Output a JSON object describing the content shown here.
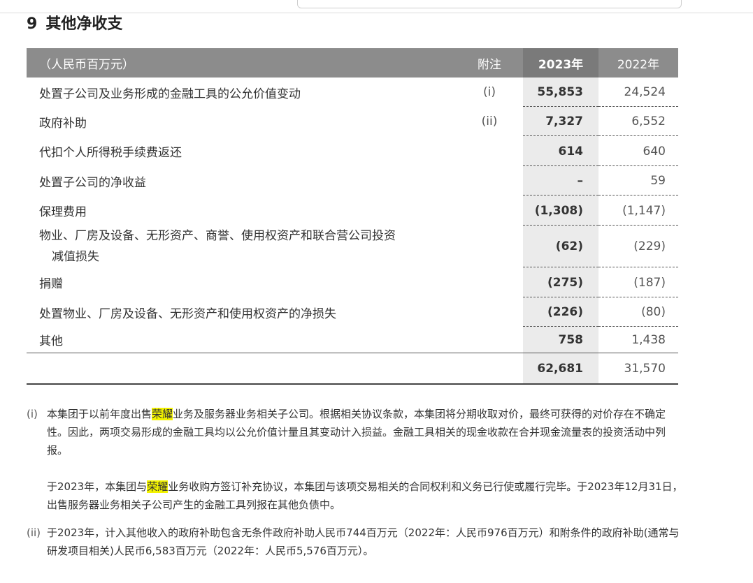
{
  "section": {
    "number": "9",
    "title": "其他净收支"
  },
  "table": {
    "header": {
      "label": "（人民币百万元）",
      "note": "附注",
      "col_2023": "2023年",
      "col_2022": "2022年"
    },
    "rows": [
      {
        "label": "处置子公司及业务形成的金融工具的公允价值变动",
        "note": "(i)",
        "v2023": "55,853",
        "v2022": "24,524"
      },
      {
        "label": "政府补助",
        "note": "(ii)",
        "v2023": "7,327",
        "v2022": "6,552"
      },
      {
        "label": "代扣个人所得税手续费返还",
        "note": "",
        "v2023": "614",
        "v2022": "640"
      },
      {
        "label": "处置子公司的净收益",
        "note": "",
        "v2023": "–",
        "v2022": "59"
      },
      {
        "label": "保理费用",
        "note": "",
        "v2023": "(1,308)",
        "v2022": "(1,147)"
      },
      {
        "label": "物业、厂房及设备、无形资产、商誉、使用权资产和联合营公司投资",
        "label2": "减值损失",
        "note": "",
        "v2023": "(62)",
        "v2022": "(229)"
      },
      {
        "label": "捐赠",
        "note": "",
        "v2023": "(275)",
        "v2022": "(187)"
      },
      {
        "label": "处置物业、厂房及设备、无形资产和使用权资产的净损失",
        "note": "",
        "v2023": "(226)",
        "v2022": "(80)"
      },
      {
        "label": "其他",
        "note": "",
        "v2023": "758",
        "v2022": "1,438"
      }
    ],
    "total": {
      "v2023": "62,681",
      "v2022": "31,570"
    }
  },
  "notes": {
    "i": {
      "mark": "(i)",
      "p1_a": "本集团于以前年度出售",
      "p1_hl": "荣耀",
      "p1_b": "业务及服务器业务相关子公司。根据相关协议条款，本集团将分期收取对价，最终可获得的对价存在不确定性。因此，两项交易形成的金融工具均以公允价值计量且其变动计入损益。金融工具相关的现金收款在合并现金流量表的投资活动中列报。",
      "p2_a": "于2023年，本集团与",
      "p2_hl": "荣耀",
      "p2_b": "业务收购方签订补充协议，本集团与该项交易相关的合同权利和义务已行使或履行完毕。于2023年12月31日，出售服务器业务相关子公司产生的金融工具列报在其他负债中。"
    },
    "ii": {
      "mark": "(ii)",
      "text": "于2023年，计入其他收入的政府补助包含无条件政府补助人民币744百万元（2022年：人民币976百万元）和附条件的政府补助(通常与研发项目相关)人民币6,583百万元（2022年：人民币5,576百万元）。"
    }
  },
  "colors": {
    "header_bg": "#8c8c8c",
    "current_year_header_bg": "#7a7a7a",
    "current_year_col_bg": "#ebebeb",
    "highlight": "#f3f300"
  }
}
